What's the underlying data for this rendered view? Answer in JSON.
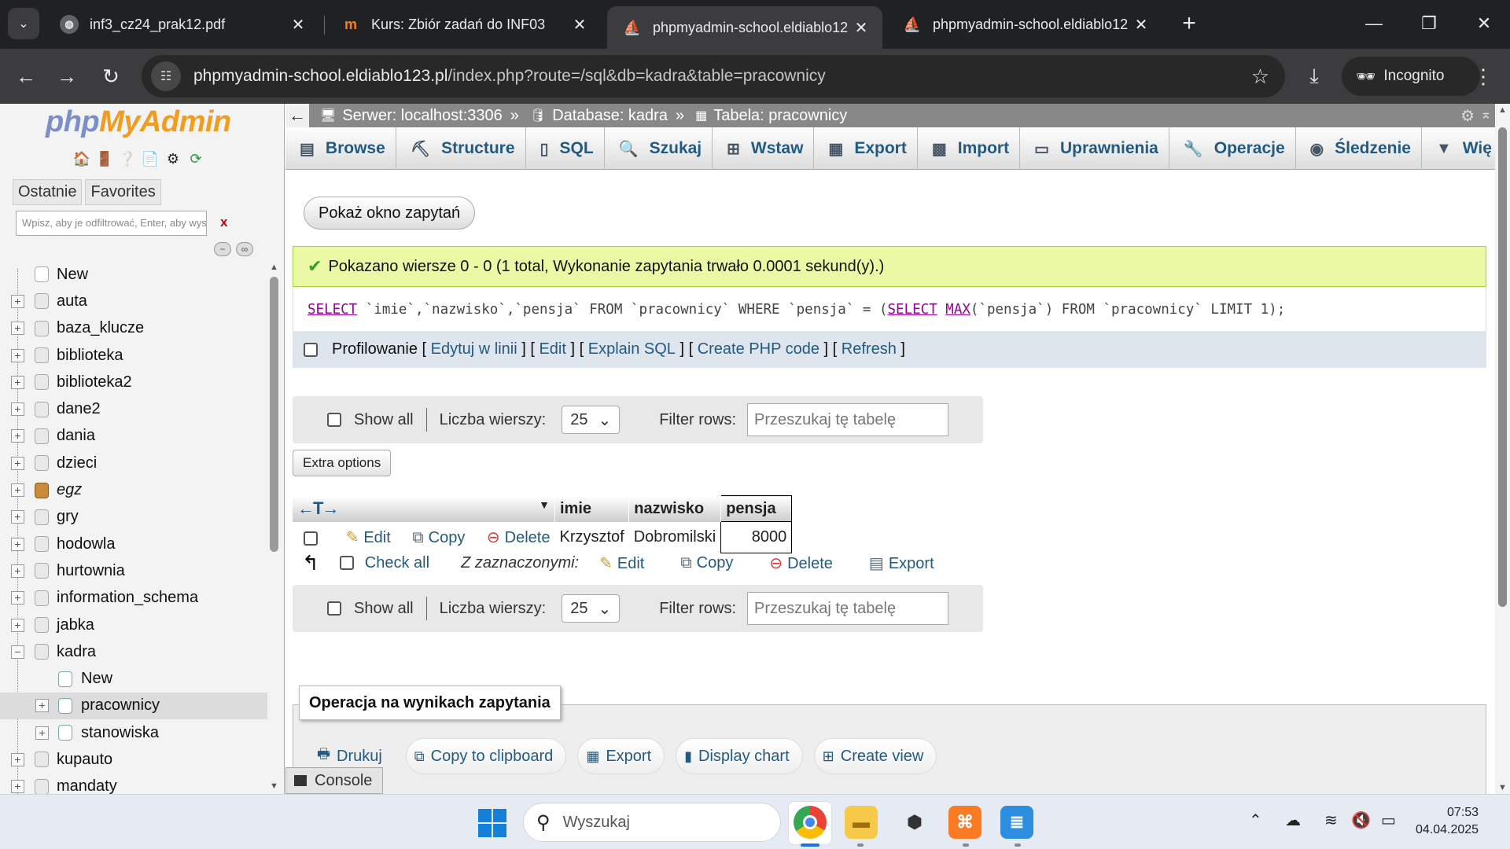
{
  "browser": {
    "tabs": [
      {
        "label": "inf3_cz24_prak12.pdf",
        "icon": "globe-icon"
      },
      {
        "label": "Kurs: Zbiór zadań do INF03",
        "icon": "moodle-icon"
      },
      {
        "label": "phpmyadmin-school.eldiablo12",
        "icon": "phpmyadmin-icon",
        "active": true
      },
      {
        "label": "phpmyadmin-school.eldiablo12",
        "icon": "phpmyadmin-icon"
      }
    ],
    "url_host": "phpmyadmin-school.eldiablo123.pl",
    "url_path": "/index.php?route=/sql&db=kadra&table=pracownicy",
    "incognito_label": "Incognito"
  },
  "nav": {
    "logo_part1": "php",
    "logo_part2": "MyAdmin",
    "tabs": [
      "Ostatnie",
      "Favorites"
    ],
    "filter_placeholder": "Wpisz, aby je odfiltrować, Enter, aby wyszukać wszystkie",
    "filter_clear": "x",
    "tree": [
      {
        "label": "New",
        "level": 1,
        "type": "new"
      },
      {
        "label": "auta",
        "level": 1,
        "type": "db"
      },
      {
        "label": "baza_klucze",
        "level": 1,
        "type": "db"
      },
      {
        "label": "biblioteka",
        "level": 1,
        "type": "db"
      },
      {
        "label": "biblioteka2",
        "level": 1,
        "type": "db"
      },
      {
        "label": "dane2",
        "level": 1,
        "type": "db"
      },
      {
        "label": "dania",
        "level": 1,
        "type": "db"
      },
      {
        "label": "dzieci",
        "level": 1,
        "type": "db"
      },
      {
        "label": "egz",
        "level": 1,
        "type": "egz"
      },
      {
        "label": "gry",
        "level": 1,
        "type": "db"
      },
      {
        "label": "hodowla",
        "level": 1,
        "type": "db"
      },
      {
        "label": "hurtownia",
        "level": 1,
        "type": "db"
      },
      {
        "label": "information_schema",
        "level": 1,
        "type": "db"
      },
      {
        "label": "jabka",
        "level": 1,
        "type": "db"
      },
      {
        "label": "kadra",
        "level": 1,
        "type": "db",
        "expanded": true
      },
      {
        "label": "New",
        "level": 2,
        "type": "new"
      },
      {
        "label": "pracownicy",
        "level": 2,
        "type": "table",
        "selected": true
      },
      {
        "label": "stanowiska",
        "level": 2,
        "type": "table"
      },
      {
        "label": "kupauto",
        "level": 1,
        "type": "db"
      },
      {
        "label": "mandaty",
        "level": 1,
        "type": "db"
      }
    ]
  },
  "breadcrumb": {
    "server": "Serwer: localhost:3306",
    "database": "Database: kadra",
    "table": "Tabela: pracownicy",
    "separator": "»"
  },
  "topmenu": [
    {
      "label": "Browse",
      "icon": "browse-icon"
    },
    {
      "label": "Structure",
      "icon": "structure-icon"
    },
    {
      "label": "SQL",
      "icon": "sql-icon"
    },
    {
      "label": "Szukaj",
      "icon": "search-icon"
    },
    {
      "label": "Wstaw",
      "icon": "insert-icon"
    },
    {
      "label": "Export",
      "icon": "export-icon"
    },
    {
      "label": "Import",
      "icon": "import-icon"
    },
    {
      "label": "Uprawnienia",
      "icon": "privileges-icon"
    },
    {
      "label": "Operacje",
      "icon": "wrench-icon"
    },
    {
      "label": "Śledzenie",
      "icon": "eye-icon"
    },
    {
      "label": "Wię",
      "icon": "chevron-down-icon"
    }
  ],
  "query": {
    "show_window_button": "Pokaż okno zapytań",
    "success_message": "Pokazano wiersze 0 - 0 (1 total, Wykonanie zapytania trwało 0.0001 sekund(y).)",
    "sql_tokens": [
      {
        "t": "SELECT",
        "kw": true
      },
      {
        "t": " `imie`,`nazwisko`,`pensja` FROM `pracownicy` WHERE `pensja` = (",
        "kw": false
      },
      {
        "t": "SELECT",
        "kw": true
      },
      {
        "t": " ",
        "kw": false
      },
      {
        "t": "MAX",
        "kw": true
      },
      {
        "t": "(`pensja`) FROM `pracownicy` LIMIT 1);",
        "kw": false
      }
    ],
    "profiling_label": "Profilowanie",
    "links": [
      "Edytuj w linii",
      "Edit",
      "Explain SQL",
      "Create PHP code",
      "Refresh"
    ]
  },
  "navigation_bar": {
    "show_all": "Show all",
    "rows_label": "Liczba wierszy:",
    "rows_value": "25",
    "filter_label": "Filter rows:",
    "filter_placeholder": "Przeszukaj tę tabelę"
  },
  "extra_options": "Extra options",
  "results": {
    "columns": [
      "imie",
      "nazwisko",
      "pensja"
    ],
    "rows": [
      {
        "imie": "Krzysztof",
        "nazwisko": "Dobromilski",
        "pensja": "8000"
      }
    ],
    "row_actions": {
      "edit": "Edit",
      "copy": "Copy",
      "delete": "Delete"
    }
  },
  "bulk": {
    "check_all": "Check all",
    "with_selected": "Z zaznaczonymi:",
    "edit": "Edit",
    "copy": "Copy",
    "delete": "Delete",
    "export": "Export"
  },
  "operations": {
    "legend": "Operacja na wynikach zapytania",
    "buttons": [
      {
        "label": "Drukuj",
        "icon": "print-icon"
      },
      {
        "label": "Copy to clipboard",
        "icon": "clipboard-icon"
      },
      {
        "label": "Export",
        "icon": "export-icon"
      },
      {
        "label": "Display chart",
        "icon": "chart-icon"
      },
      {
        "label": "Create view",
        "icon": "view-icon"
      }
    ]
  },
  "console_label": "Console",
  "taskbar": {
    "search_placeholder": "Wyszukaj",
    "time": "07:53",
    "date": "04.04.2025"
  }
}
